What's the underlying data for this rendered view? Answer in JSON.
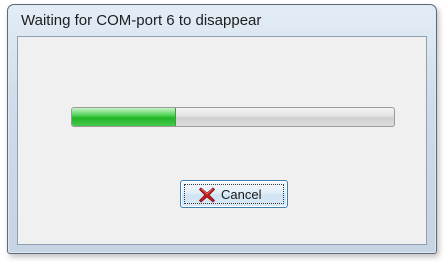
{
  "window": {
    "title": "Waiting for COM-port 6 to disappear"
  },
  "progress": {
    "value": 0.32,
    "color": "#22b528"
  },
  "cancel_button": {
    "label": "Cancel",
    "icon": "red-x-icon",
    "icon_color": "#c81e1e"
  }
}
